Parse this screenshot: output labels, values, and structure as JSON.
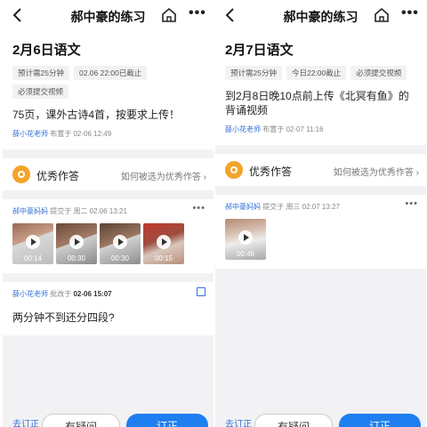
{
  "screens": [
    {
      "title": "郝中豪的练习",
      "homework_title": "2月6日语文",
      "tags": [
        "预计需25分钟",
        "02.06 22:00已截止",
        "必须提交视频"
      ],
      "content": "75页，课外古诗4首，按要求上传！",
      "teacher_name": "薛小花老师",
      "publish_info": "布置于 02-06 12:49",
      "excellent_label": "优秀作答",
      "excellent_link": "如何被选为优秀作答",
      "submission": {
        "submitter": "郝中豪妈妈",
        "info": "提交于 周二 02.06 13:21",
        "videos": [
          {
            "duration": "00:14"
          },
          {
            "duration": "00:30"
          },
          {
            "duration": "00:30"
          },
          {
            "duration": "00:15"
          }
        ]
      },
      "review": {
        "teacher": "薛小花老师",
        "label": "批改于",
        "date": "02-06 15:07",
        "text": "两分钟不到还分四段?"
      },
      "bottom": {
        "text": "去订正",
        "button1": "有疑问",
        "button2": "订正"
      }
    },
    {
      "title": "郝中豪的练习",
      "homework_title": "2月7日语文",
      "tags": [
        "预计需25分钟",
        "今日22:00截止",
        "必须提交视频"
      ],
      "content": "到2月8日晚10点前上传《北冥有鱼》的背诵视频",
      "teacher_name": "薛小花老师",
      "publish_info": "布置于 02-07 11:16",
      "excellent_label": "优秀作答",
      "excellent_link": "如何被选为优秀作答",
      "submission": {
        "submitter": "郝中豪妈妈",
        "info": "提交于 周三 02.07 13:27",
        "videos": [
          {
            "duration": "00:46"
          }
        ]
      },
      "bottom": {
        "text": "去订正",
        "button1": "有疑问",
        "button2": "订正"
      }
    }
  ],
  "icons": {
    "back": "back-arrow-icon",
    "home": "home-icon",
    "more": "more-dots-icon",
    "medal": "medal-icon",
    "play": "play-icon",
    "edit": "edit-icon"
  },
  "colors": {
    "accent": "#1f7ff0",
    "link": "#2f6fd6",
    "medal": "#f3a42a",
    "background": "#f2f2f4"
  }
}
